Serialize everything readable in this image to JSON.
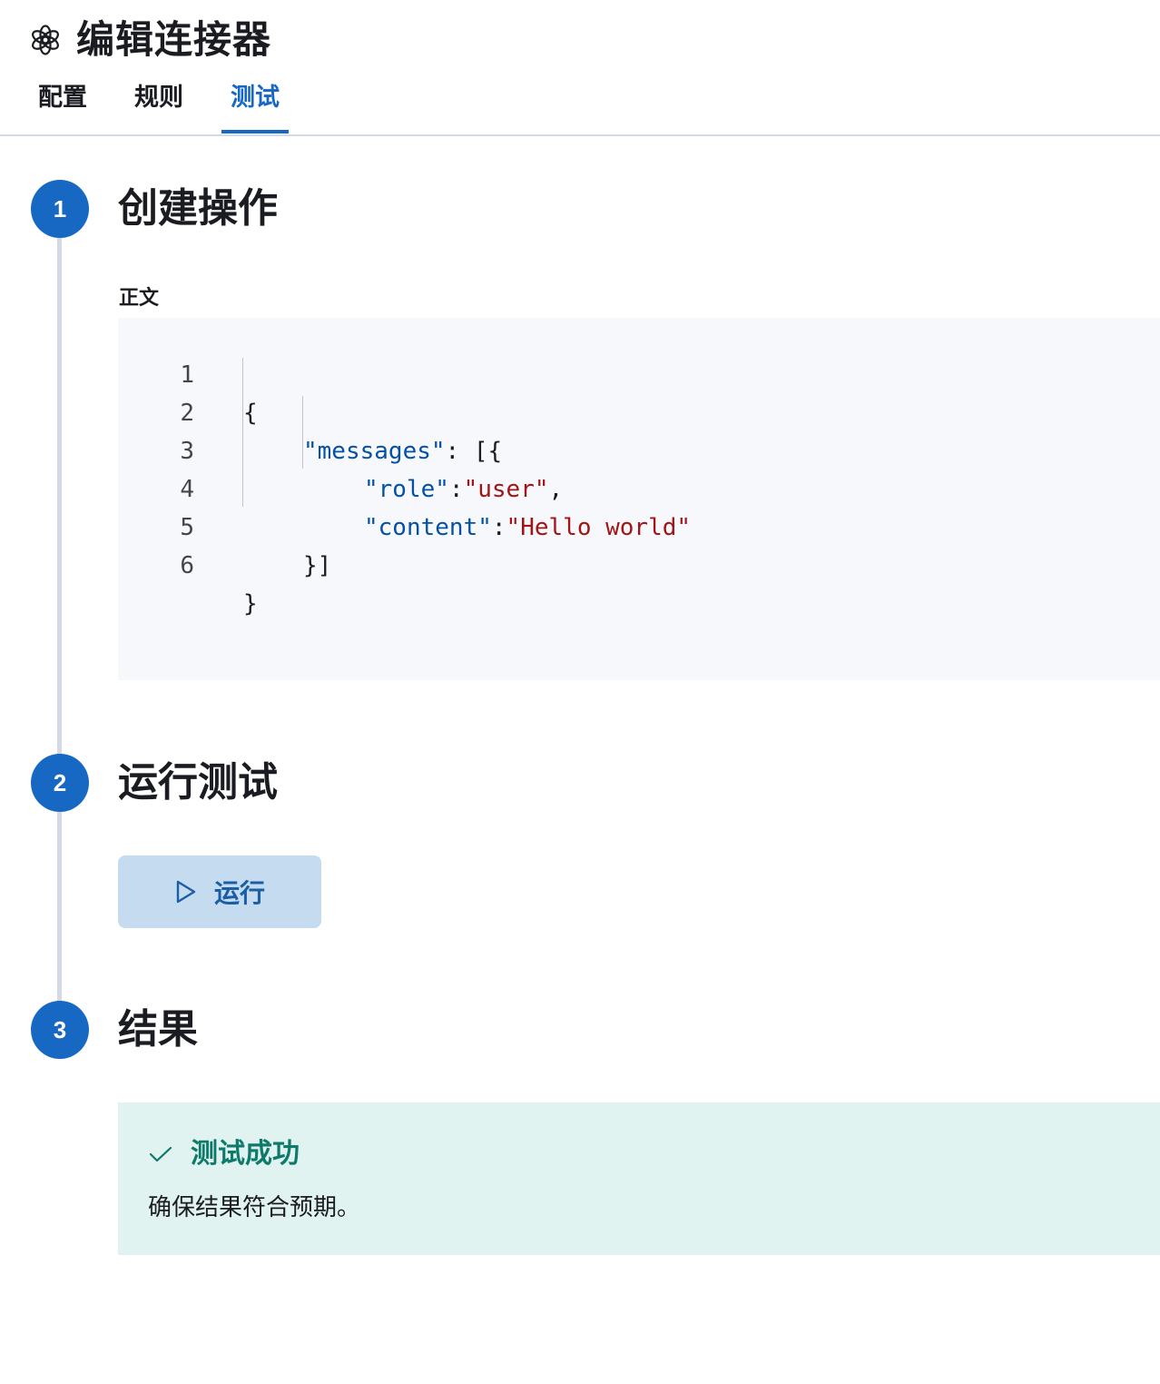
{
  "header": {
    "title": "编辑连接器",
    "logo_icon": "openai-logo-icon",
    "tabs": [
      {
        "label": "配置",
        "active": false
      },
      {
        "label": "规则",
        "active": false
      },
      {
        "label": "测试",
        "active": true
      }
    ]
  },
  "steps": [
    {
      "number": "1",
      "title": "创建操作"
    },
    {
      "number": "2",
      "title": "运行测试"
    },
    {
      "number": "3",
      "title": "结果"
    }
  ],
  "editor": {
    "label": "正文",
    "line_numbers": [
      "1",
      "2",
      "3",
      "4",
      "5",
      "6"
    ],
    "code": {
      "l1": "{",
      "l2_key": "\"messages\"",
      "l2_rest": ": [{",
      "l3_key": "\"role\"",
      "l3_sep": ":",
      "l3_val": "\"user\"",
      "l3_end": ",",
      "l4_key": "\"content\"",
      "l4_sep": ":",
      "l4_val": "\"Hello world\"",
      "l5": "}]",
      "l6": "}"
    }
  },
  "run": {
    "label": "运行",
    "icon": "play-icon"
  },
  "result": {
    "icon": "check-icon",
    "title": "测试成功",
    "text": "确保结果符合预期。"
  },
  "colors": {
    "primary": "#1668c2",
    "success": "#0e7a6a",
    "success_bg": "#e1f3f1",
    "button_bg": "#c5dcf0",
    "json_key": "#0451a5",
    "json_string": "#a31515",
    "editor_bg": "#f7f8fc"
  }
}
